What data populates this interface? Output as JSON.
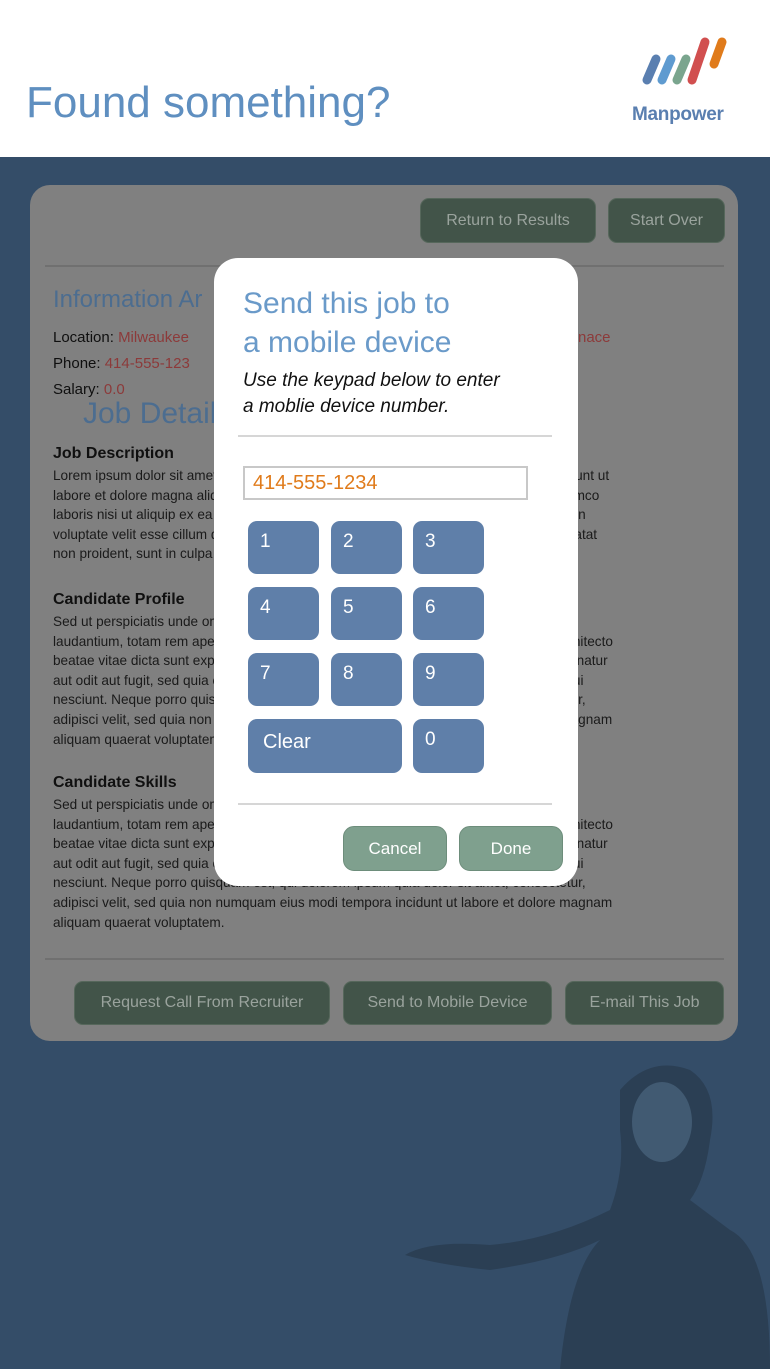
{
  "header": {
    "headline": "Found something?",
    "brand": "Manpower",
    "brand_colors": [
      "#5a7fb0",
      "#5f9bd0",
      "#7aa58e",
      "#d14f4f",
      "#e07b1b"
    ]
  },
  "job_detail": {
    "title": "Job Detail",
    "return_label": "Return to Results",
    "start_over_label": "Start Over",
    "info_heading": "Information Ar",
    "location_label": "Location:",
    "location_value": "Milwaukee",
    "location_right_fragment": "nace",
    "phone_label": "Phone:",
    "phone_value": "414-555-123",
    "salary_label": "Salary:",
    "salary_value": "0.0",
    "sections": [
      {
        "heading": "Job Description",
        "lines": [
          "Lorem ipsum dolor sit amet, consectetur adipisicing elit, sed do eiusmod tempor incididunt ut",
          "labore et dolore magna aliqua. Ut enim ad minim veniam, quis nostrud exercitation ullamco",
          "laboris nisi ut aliquip ex ea commodo consequat. Duis aute irure dolor in reprehenderit in",
          "voluptate velit esse cillum dolore eu fugiat nulla pariatur. Excepteur sint occaecat cupidatat",
          "non proident, sunt in culpa qui officia deserunt mollit anim id est laborum."
        ]
      },
      {
        "heading": "Candidate Profile",
        "lines": [
          "Sed ut perspiciatis unde omnis iste natus error sit voluptatem accusantium doloremque",
          "laudantium, totam rem aperiam, eaque ipsa quae ab illo inventore veritatis et quasi architecto",
          "beatae vitae dicta sunt explicabo. Nemo enim ipsam voluptatem quia voluptas sit aspernatur",
          "aut odit aut fugit, sed quia consequuntur magni dolores eos qui ratione voluptatem sequi",
          "nesciunt. Neque porro quisquam est, qui dolorem ipsum quia dolor sit amet, consectetur,",
          "adipisci velit, sed quia non numquam eius modi tempora incidunt ut labore et dolore magnam",
          "aliquam quaerat voluptatem."
        ]
      },
      {
        "heading": "Candidate Skills",
        "lines": [
          "Sed ut perspiciatis unde omnis iste natus error sit voluptatem accusantium doloremque",
          "laudantium, totam rem aperiam, eaque ipsa quae ab illo inventore veritatis et quasi architecto",
          "beatae vitae dicta sunt explicabo. Nemo enim ipsam voluptatem quia voluptas sit aspernatur",
          "aut odit aut fugit, sed quia consequuntur magni dolores eos qui ratione voluptatem sequi",
          "nesciunt. Neque porro quisquam est, qui dolorem ipsum quia dolor sit amet, consectetur,",
          "adipisci velit, sed quia non numquam eius modi tempora incidunt ut labore et dolore magnam",
          "aliquam quaerat voluptatem."
        ]
      }
    ],
    "actions": [
      "Request Call From Recruiter",
      "Send to Mobile Device",
      "E-mail This Job"
    ]
  },
  "modal": {
    "title_line1": "Send this job to",
    "title_line2": "a mobile device",
    "subtitle_line1": "Use the keypad below to enter",
    "subtitle_line2": "a moblie device number.",
    "phone_value": "414-555-1234",
    "keys": [
      "1",
      "2",
      "3",
      "4",
      "5",
      "6",
      "7",
      "8",
      "9",
      "Clear",
      "0"
    ],
    "cancel_label": "Cancel",
    "done_label": "Done"
  }
}
